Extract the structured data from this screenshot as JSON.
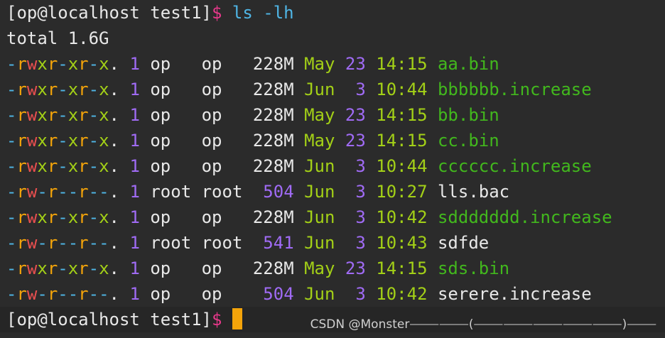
{
  "prompt": {
    "text": "[op@localhost test1]",
    "sign": "$",
    "command": "ls -lh"
  },
  "total": "total 1.6G",
  "rows": [
    {
      "perm": [
        "-",
        "r",
        "w",
        "x",
        "r",
        "-",
        "x",
        "r",
        "-",
        "x",
        "."
      ],
      "links": "1",
      "owner": "op  ",
      "group": "op  ",
      "size": "228M",
      "month": "May",
      "day": "23",
      "time": "14:15",
      "name": "aa.bin",
      "name_color": "green"
    },
    {
      "perm": [
        "-",
        "r",
        "w",
        "x",
        "r",
        "-",
        "x",
        "r",
        "-",
        "x",
        "."
      ],
      "links": "1",
      "owner": "op  ",
      "group": "op  ",
      "size": "228M",
      "month": "Jun",
      "day": " 3",
      "time": "10:44",
      "name": "bbbbbb.increase",
      "name_color": "green"
    },
    {
      "perm": [
        "-",
        "r",
        "w",
        "x",
        "r",
        "-",
        "x",
        "r",
        "-",
        "x",
        "."
      ],
      "links": "1",
      "owner": "op  ",
      "group": "op  ",
      "size": "228M",
      "month": "May",
      "day": "23",
      "time": "14:15",
      "name": "bb.bin",
      "name_color": "green"
    },
    {
      "perm": [
        "-",
        "r",
        "w",
        "x",
        "r",
        "-",
        "x",
        "r",
        "-",
        "x",
        "."
      ],
      "links": "1",
      "owner": "op  ",
      "group": "op  ",
      "size": "228M",
      "month": "May",
      "day": "23",
      "time": "14:15",
      "name": "cc.bin",
      "name_color": "green"
    },
    {
      "perm": [
        "-",
        "r",
        "w",
        "x",
        "r",
        "-",
        "x",
        "r",
        "-",
        "x",
        "."
      ],
      "links": "1",
      "owner": "op  ",
      "group": "op  ",
      "size": "228M",
      "month": "Jun",
      "day": " 3",
      "time": "10:44",
      "name": "cccccc.increase",
      "name_color": "green"
    },
    {
      "perm": [
        "-",
        "r",
        "w",
        "-",
        "r",
        "-",
        "-",
        "r",
        "-",
        "-",
        "."
      ],
      "links": "1",
      "owner": "root",
      "group": "root",
      "size": " 504",
      "month": "Jun",
      "day": " 3",
      "time": "10:27",
      "name": "lls.bac",
      "name_color": "white"
    },
    {
      "perm": [
        "-",
        "r",
        "w",
        "x",
        "r",
        "-",
        "x",
        "r",
        "-",
        "x",
        "."
      ],
      "links": "1",
      "owner": "op  ",
      "group": "op  ",
      "size": "228M",
      "month": "Jun",
      "day": " 3",
      "time": "10:42",
      "name": "sddddddd.increase",
      "name_color": "green"
    },
    {
      "perm": [
        "-",
        "r",
        "w",
        "-",
        "r",
        "-",
        "-",
        "r",
        "-",
        "-",
        "."
      ],
      "links": "1",
      "owner": "root",
      "group": "root",
      "size": " 541",
      "month": "Jun",
      "day": " 3",
      "time": "10:43",
      "name": "sdfde",
      "name_color": "white"
    },
    {
      "perm": [
        "-",
        "r",
        "w",
        "x",
        "r",
        "-",
        "x",
        "r",
        "-",
        "x",
        "."
      ],
      "links": "1",
      "owner": "op  ",
      "group": "op  ",
      "size": "228M",
      "month": "May",
      "day": "23",
      "time": "14:15",
      "name": "sds.bin",
      "name_color": "green"
    },
    {
      "perm": [
        "-",
        "r",
        "w",
        "-",
        "r",
        "-",
        "-",
        "r",
        "-",
        "-",
        "."
      ],
      "links": "1",
      "owner": "op  ",
      "group": "op  ",
      "size": " 504",
      "month": "Jun",
      "day": " 3",
      "time": "10:42",
      "name": "serere.increase",
      "name_color": "white"
    }
  ],
  "watermark": "CSDN @Monster⸻⸻(⸻⸻⸻⸻⸻)⸻",
  "colors": {
    "background": "#2b2b2b",
    "prompt_sign": "#e8388b",
    "command": "#4fb6e6",
    "perm_dash": "#4fb6e6",
    "perm_r": "#f4a40a",
    "perm_w": "#e94f4f",
    "perm_x": "#a3d017",
    "number": "#a06bf5",
    "date": "#a3d017",
    "exec_file": "#42b81d",
    "cursor": "#f4a40a"
  }
}
